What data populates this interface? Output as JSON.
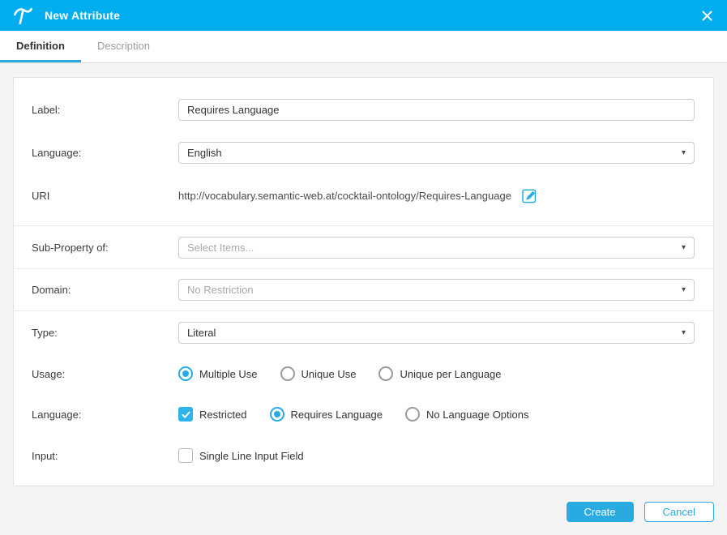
{
  "header": {
    "title": "New Attribute"
  },
  "tabs": [
    {
      "label": "Definition",
      "active": true
    },
    {
      "label": "Description",
      "active": false
    }
  ],
  "form": {
    "label_field": {
      "label": "Label:",
      "value": "Requires Language"
    },
    "language_field": {
      "label": "Language:",
      "value": "English"
    },
    "uri": {
      "label": "URI",
      "value": "http://vocabulary.semantic-web.at/cocktail-ontology/Requires-Language"
    },
    "sub_property": {
      "label": "Sub-Property of:",
      "placeholder": "Select Items..."
    },
    "domain": {
      "label": "Domain:",
      "placeholder": "No Restriction"
    },
    "type": {
      "label": "Type:",
      "value": "Literal"
    },
    "usage": {
      "label": "Usage:",
      "options": [
        {
          "label": "Multiple Use",
          "selected": true
        },
        {
          "label": "Unique Use",
          "selected": false
        },
        {
          "label": "Unique per Language",
          "selected": false
        }
      ]
    },
    "language_options": {
      "label": "Language:",
      "checkbox": {
        "label": "Restricted",
        "checked": true
      },
      "options": [
        {
          "label": "Requires Language",
          "selected": true
        },
        {
          "label": "No Language Options",
          "selected": false
        }
      ]
    },
    "input_options": {
      "label": "Input:",
      "checkbox": {
        "label": "Single Line Input Field",
        "checked": false
      }
    }
  },
  "footer": {
    "create_label": "Create",
    "cancel_label": "Cancel"
  },
  "icons": {
    "logo": "poolparty-logo",
    "close": "close-x",
    "uri_edit": "edit-pencil",
    "select_caret": "chevron-down"
  },
  "colors": {
    "header_bg": "#00aeef",
    "accent": "#29abe2",
    "checkbox_fill": "#2fb3ec",
    "content_bg": "#f4f4f5",
    "card_border": "#e2e2e2"
  }
}
